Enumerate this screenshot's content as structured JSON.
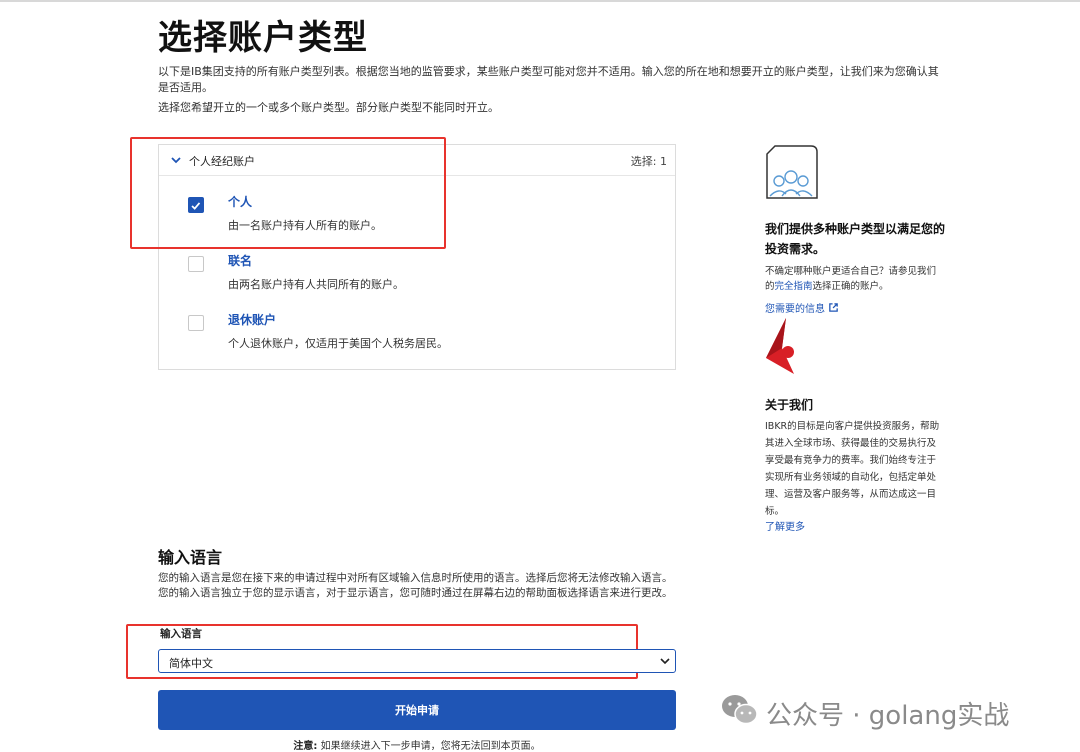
{
  "header": {
    "title": "选择账户类型",
    "intro": "以下是IB集团支持的所有账户类型列表。根据您当地的监管要求，某些账户类型可能对您并不适用。输入您的所在地和想要开立的账户类型，让我们来为您确认其是否适用。",
    "instruction": "选择您希望开立的一个或多个账户类型。部分账户类型不能同时开立。"
  },
  "accounts": {
    "section_title": "个人经纪账户",
    "selected_count": "选择: 1",
    "options": [
      {
        "title": "个人",
        "desc": "由一名账户持有人所有的账户。",
        "checked": true
      },
      {
        "title": "联名",
        "desc": "由两名账户持有人共同所有的账户。",
        "checked": false
      },
      {
        "title": "退休账户",
        "desc": "个人退休账户，仅适用于美国个人税务居民。",
        "checked": false
      }
    ]
  },
  "sidebar": {
    "heading": "我们提供多种账户类型以满足您的投资需求。",
    "text_before_link": "不确定哪种账户更适合自己？请参见我们的",
    "guide_link": "完全指南",
    "text_after_link": "选择正确的账户。",
    "info_link": "您需要的信息",
    "about_title": "关于我们",
    "about_text": "IBKR的目标是向客户提供投资服务，帮助其进入全球市场、获得最佳的交易执行及享受最有竞争力的费率。我们始终专注于实现所有业务领域的自动化，包括定单处理、运营及客户服务等，从而达成这一目标。",
    "learn_more": "了解更多"
  },
  "language": {
    "heading": "输入语言",
    "description": "您的输入语言是您在接下来的申请过程中对所有区域输入信息时所使用的语言。选择后您将无法修改输入语言。您的输入语言独立于您的显示语言，对于显示语言，您可随时通过在屏幕右边的帮助面板选择语言来进行更改。",
    "field_label": "输入语言",
    "selected_value": "简体中文"
  },
  "actions": {
    "start_label": "开始申请",
    "note_prefix": "注意:",
    "note_text": " 如果继续进入下一步申请，您将无法回到本页面。"
  },
  "watermark": {
    "text": "公众号 · golang实战"
  },
  "colors": {
    "accent": "#1f55b5",
    "annotation_red": "#e8332d",
    "logo_red": "#d81f26"
  }
}
